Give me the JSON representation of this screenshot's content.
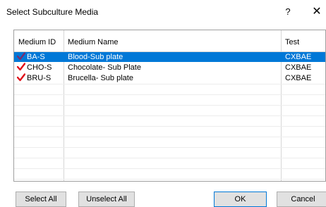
{
  "window": {
    "title": "Select Subculture Media",
    "help_glyph": "?",
    "close_glyph": "✕"
  },
  "table": {
    "columns": [
      "Medium ID",
      "Medium Name",
      "Test"
    ],
    "rows": [
      {
        "id": "BA-S",
        "name": "Blood-Sub plate",
        "test": "CXBAE",
        "checked": true,
        "selected": true
      },
      {
        "id": "CHO-S",
        "name": "Chocolate- Sub Plate",
        "test": "CXBAE",
        "checked": true,
        "selected": false
      },
      {
        "id": "BRU-S",
        "name": "Brucella- Sub plate",
        "test": "CXBAE",
        "checked": true,
        "selected": false
      }
    ]
  },
  "buttons": {
    "select_all": "Select All",
    "unselect_all": "Unselect All",
    "ok": "OK",
    "cancel": "Cancel"
  },
  "colors": {
    "selection": "#0078d7",
    "check_selected": "#7a2e6e",
    "check": "#e0101a"
  }
}
